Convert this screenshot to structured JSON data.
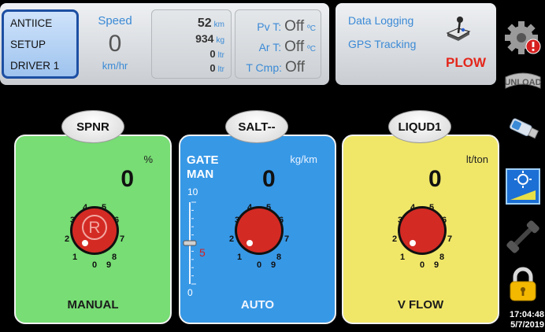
{
  "mode": {
    "antiice": "ANTIICE",
    "setup": "SETUP",
    "driver": "DRIVER 1"
  },
  "speed": {
    "label": "Speed",
    "value": "0",
    "unit": "km/hr"
  },
  "counters": [
    {
      "value": "52",
      "unit": "km"
    },
    {
      "value": "934",
      "unit": "kg"
    },
    {
      "value": "0",
      "unit": "ltr"
    },
    {
      "value": "0",
      "unit": "ltr"
    }
  ],
  "temps": {
    "pv": {
      "label": "Pv T:",
      "value": "Off",
      "unit": "ºC"
    },
    "ar": {
      "label": "Ar T:",
      "value": "Off",
      "unit": "ºC"
    },
    "cmp": {
      "label": "T Cmp:",
      "value": "Off"
    }
  },
  "logging": {
    "data_logging": "Data Logging",
    "gps": "GPS Tracking",
    "plow": "PLOW"
  },
  "spinner": {
    "title": "SPNR",
    "unit": "%",
    "value": "0",
    "mode": "MANUAL",
    "dial_letter": "R"
  },
  "salt": {
    "title": "SALT--",
    "unit": "kg/km",
    "value": "0",
    "mode": "AUTO",
    "gate": "GATE",
    "man": "MAN",
    "slider_max": "10",
    "slider_mark": "5",
    "slider_min": "0",
    "slider_level": 0.5
  },
  "liquid": {
    "title": "LIQUD1",
    "unit": "lt/ton",
    "value": "0",
    "mode": "V FLOW"
  },
  "dial_numbers": [
    "0",
    "1",
    "2",
    "3",
    "4",
    "5",
    "6",
    "7",
    "8",
    "9"
  ],
  "sidebar_icons": [
    "settings-alert-icon",
    "unload-icon",
    "usb-drive-icon",
    "brightness-icon",
    "wrench-icon",
    "lock-icon"
  ],
  "clock": {
    "time": "17:04:48",
    "date": "5/7/2019"
  },
  "colors": {
    "accent_blue": "#3b8ad6",
    "plow_red": "#e4261b",
    "spinner_green": "#77dd74",
    "salt_blue": "#3798e6",
    "liquid_yellow": "#f0e769",
    "dial_red": "#d42a24"
  }
}
